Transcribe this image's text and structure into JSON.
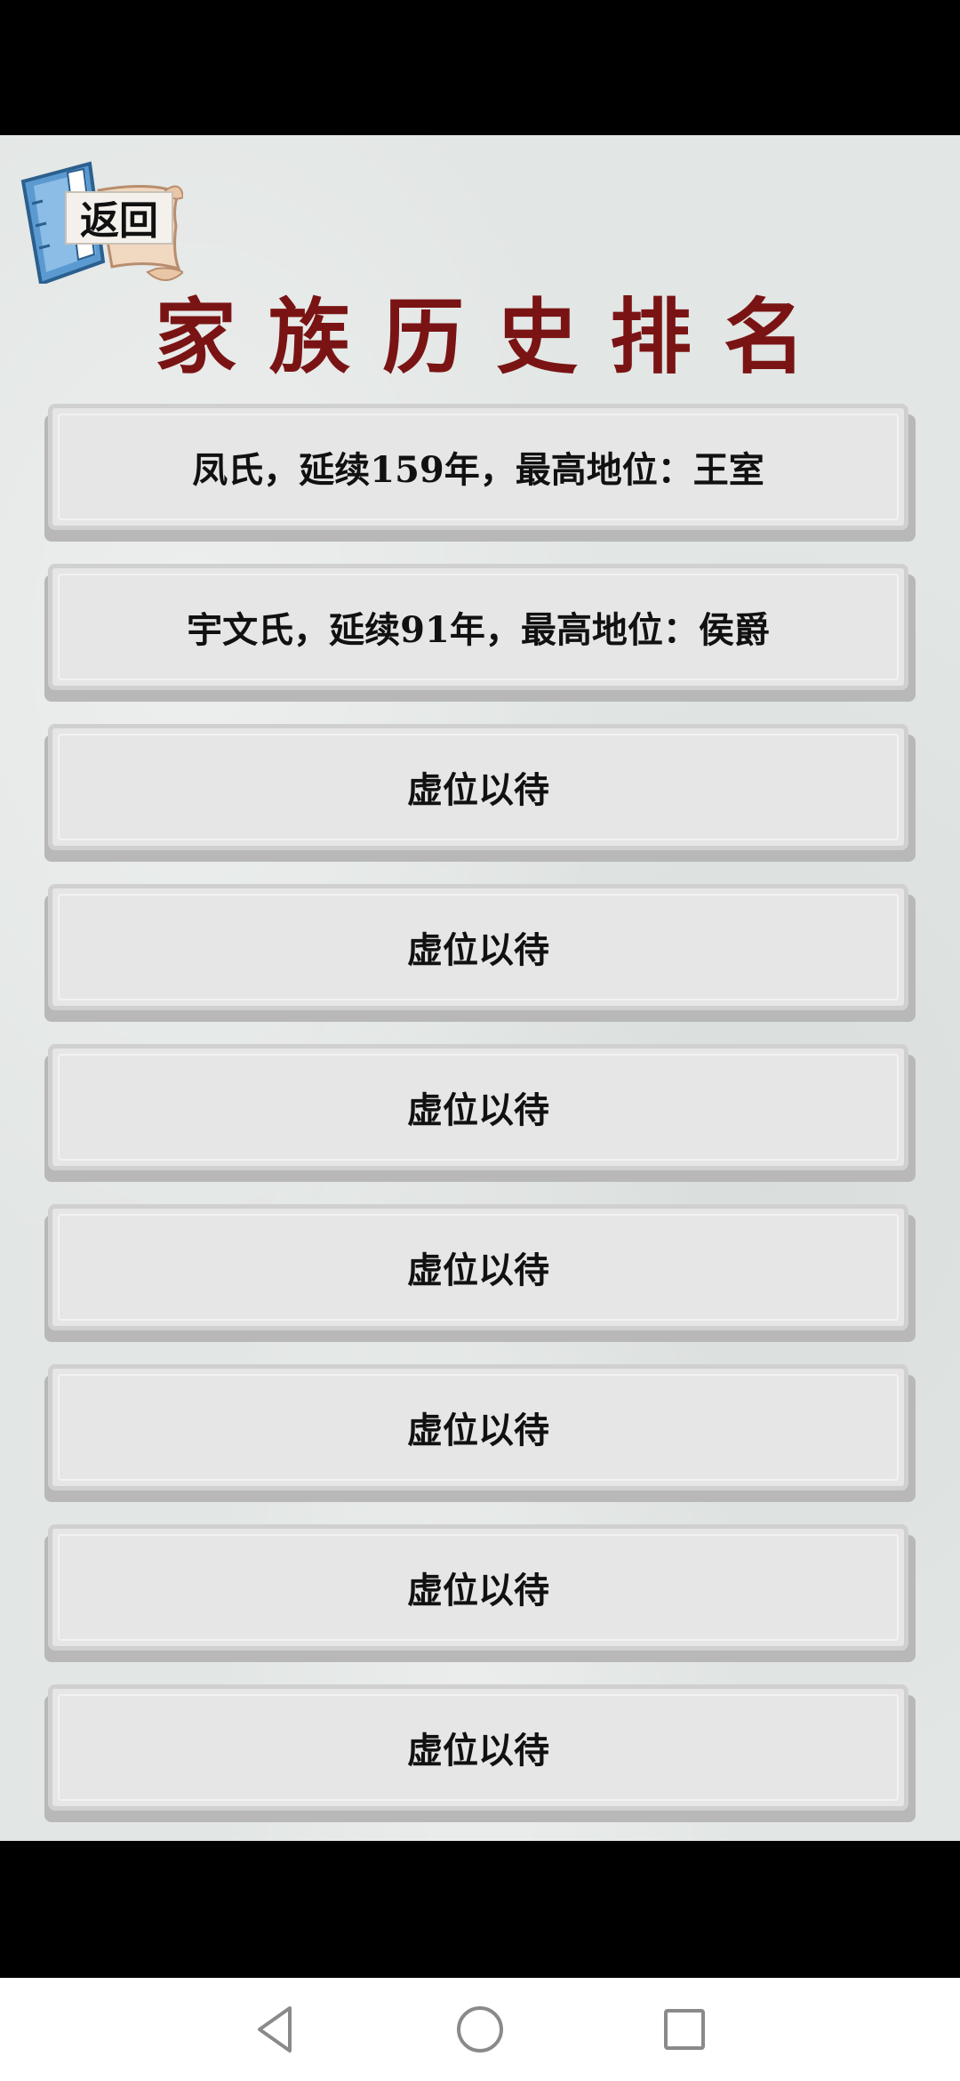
{
  "header": {
    "back_label": "返回",
    "title": "家族历史排名"
  },
  "ranking": {
    "items": [
      {
        "text": "凤氏，延续159年，最高地位：王室"
      },
      {
        "text": "宇文氏，延续91年，最高地位：侯爵"
      },
      {
        "text": "虚位以待"
      },
      {
        "text": "虚位以待"
      },
      {
        "text": "虚位以待"
      },
      {
        "text": "虚位以待"
      },
      {
        "text": "虚位以待"
      },
      {
        "text": "虚位以待"
      },
      {
        "text": "虚位以待"
      }
    ]
  },
  "navigation": {
    "buttons": [
      "back-triangle-icon",
      "home-circle-icon",
      "recents-square-icon"
    ]
  },
  "colors": {
    "title": "#7a1414",
    "card_bg": "#e6e6e6",
    "background": "#e2e6e4"
  }
}
